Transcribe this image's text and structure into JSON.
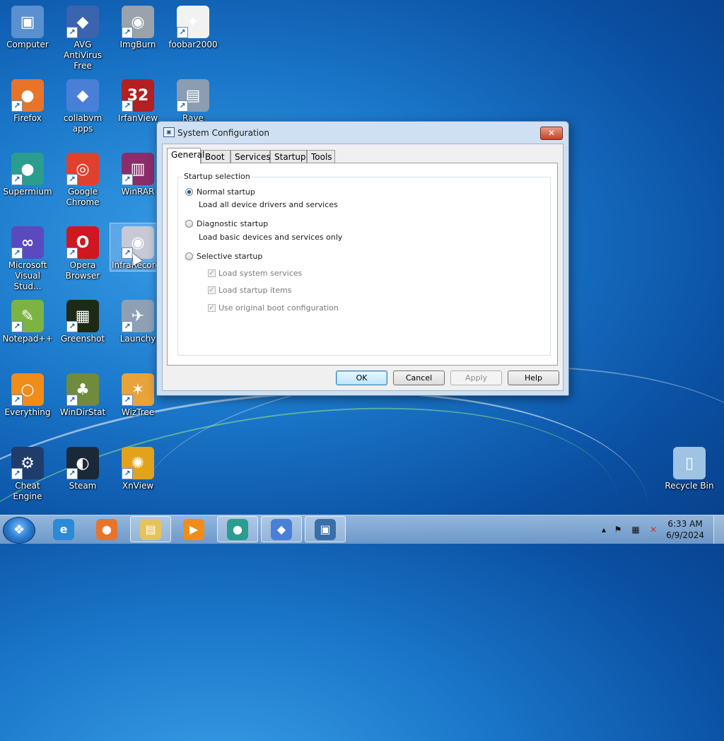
{
  "desktop": {
    "icons": [
      {
        "label": "Computer",
        "glyph": "▣",
        "color": "#5a8fd0",
        "icon": "computer-icon",
        "shortcut": false
      },
      {
        "label": "AVG AntiVirus Free",
        "glyph": "◆",
        "color": "#3a63b0",
        "icon": "avg-icon",
        "shortcut": true
      },
      {
        "label": "ImgBurn",
        "glyph": "◉",
        "color": "#9aa3ad",
        "icon": "imgburn-icon",
        "shortcut": true
      },
      {
        "label": "foobar2000",
        "glyph": "✦",
        "color": "#f2f2f2",
        "icon": "foobar-icon",
        "shortcut": true
      },
      {
        "label": "Firefox",
        "glyph": "●",
        "color": "#e8742a",
        "icon": "firefox-icon",
        "shortcut": true
      },
      {
        "label": "collabvm apps",
        "glyph": "◆",
        "color": "#4a7fd8",
        "icon": "folder-apps-icon",
        "shortcut": false
      },
      {
        "label": "IrfanView",
        "glyph": "32",
        "color": "#b41f1f",
        "icon": "irfanview-icon",
        "shortcut": true
      },
      {
        "label": "Rave",
        "glyph": "▤",
        "color": "#8a9db3",
        "icon": "rave-icon",
        "shortcut": true
      },
      {
        "label": "Supermium",
        "glyph": "●",
        "color": "#2a9d8f",
        "icon": "supermium-icon",
        "shortcut": true
      },
      {
        "label": "Google Chrome",
        "glyph": "◎",
        "color": "#e0412f",
        "icon": "chrome-icon",
        "shortcut": true
      },
      {
        "label": "WinRAR",
        "glyph": "▥",
        "color": "#8a2d6a",
        "icon": "winrar-icon",
        "shortcut": true
      },
      {
        "label": "Microsoft Visual Stud...",
        "glyph": "∞",
        "color": "#5b49c0",
        "icon": "vscode-icon",
        "shortcut": true
      },
      {
        "label": "Opera Browser",
        "glyph": "O",
        "color": "#d0161e",
        "icon": "opera-icon",
        "shortcut": true
      },
      {
        "label": "InfraRecorder",
        "glyph": "◉",
        "color": "#c7c9d6",
        "icon": "infrarecorder-icon",
        "shortcut": true
      },
      {
        "label": "Notepad++",
        "glyph": "✎",
        "color": "#7cb342",
        "icon": "notepadpp-icon",
        "shortcut": true
      },
      {
        "label": "Greenshot",
        "glyph": "▦",
        "color": "#1d2b16",
        "icon": "greenshot-icon",
        "shortcut": true
      },
      {
        "label": "Launchy",
        "glyph": "✈",
        "color": "#8fa0b5",
        "icon": "launchy-icon",
        "shortcut": true
      },
      {
        "label": "Everything",
        "glyph": "○",
        "color": "#f08c1a",
        "icon": "everything-icon",
        "shortcut": true
      },
      {
        "label": "WinDirStat",
        "glyph": "♣",
        "color": "#6f8b3b",
        "icon": "windirstat-icon",
        "shortcut": true
      },
      {
        "label": "WizTree",
        "glyph": "✶",
        "color": "#e8a33a",
        "icon": "wiztree-icon",
        "shortcut": true
      },
      {
        "label": "Cheat Engine",
        "glyph": "⚙",
        "color": "#1f3c6b",
        "icon": "cheatengine-icon",
        "shortcut": true
      },
      {
        "label": "Steam",
        "glyph": "◐",
        "color": "#1b2838",
        "icon": "steam-icon",
        "shortcut": true
      },
      {
        "label": "XnView",
        "glyph": "✺",
        "color": "#e2a21b",
        "icon": "xnview-icon",
        "shortcut": true
      },
      {
        "label": "Recycle Bin",
        "glyph": "▯",
        "color": "#9fc3e3",
        "icon": "recycle-bin-icon",
        "shortcut": false
      }
    ]
  },
  "dialog": {
    "title": "System Configuration",
    "close_glyph": "✕",
    "tabs": [
      "General",
      "Boot",
      "Services",
      "Startup",
      "Tools"
    ],
    "active_tab": "General",
    "group_title": "Startup selection",
    "options": [
      {
        "label": "Normal startup",
        "desc": "Load all device drivers and services",
        "checked": true
      },
      {
        "label": "Diagnostic startup",
        "desc": "Load basic devices and services only",
        "checked": false
      },
      {
        "label": "Selective startup",
        "desc": "",
        "checked": false
      }
    ],
    "sub_checks": [
      {
        "label": "Load system services",
        "checked": true,
        "enabled": false
      },
      {
        "label": "Load startup items",
        "checked": true,
        "enabled": false
      },
      {
        "label": "Use original boot configuration",
        "checked": true,
        "enabled": false
      }
    ],
    "buttons": {
      "ok": "OK",
      "cancel": "Cancel",
      "apply": "Apply",
      "help": "Help"
    }
  },
  "taskbar": {
    "start_glyph": "❖",
    "items": [
      {
        "icon": "internet-explorer-icon",
        "glyph": "e",
        "color": "#2a8ad8",
        "open": false
      },
      {
        "icon": "firefox-icon",
        "glyph": "●",
        "color": "#e8742a",
        "open": false
      },
      {
        "icon": "file-explorer-icon",
        "glyph": "▤",
        "color": "#e6c35a",
        "open": true
      },
      {
        "icon": "media-player-icon",
        "glyph": "▶",
        "color": "#f08c1a",
        "open": false
      },
      {
        "icon": "supermium-icon",
        "glyph": "●",
        "color": "#2a9d8f",
        "open": true
      },
      {
        "icon": "collabvm-apps-icon",
        "glyph": "◆",
        "color": "#4a7fd8",
        "open": true
      },
      {
        "icon": "system-configuration-icon",
        "glyph": "▣",
        "color": "#3a6ea8",
        "open": true
      }
    ],
    "tray": {
      "chevron": "▴",
      "flag": "⚑",
      "network": "▦",
      "volume": "✕",
      "time": "6:33 AM",
      "date": "6/9/2024"
    }
  }
}
